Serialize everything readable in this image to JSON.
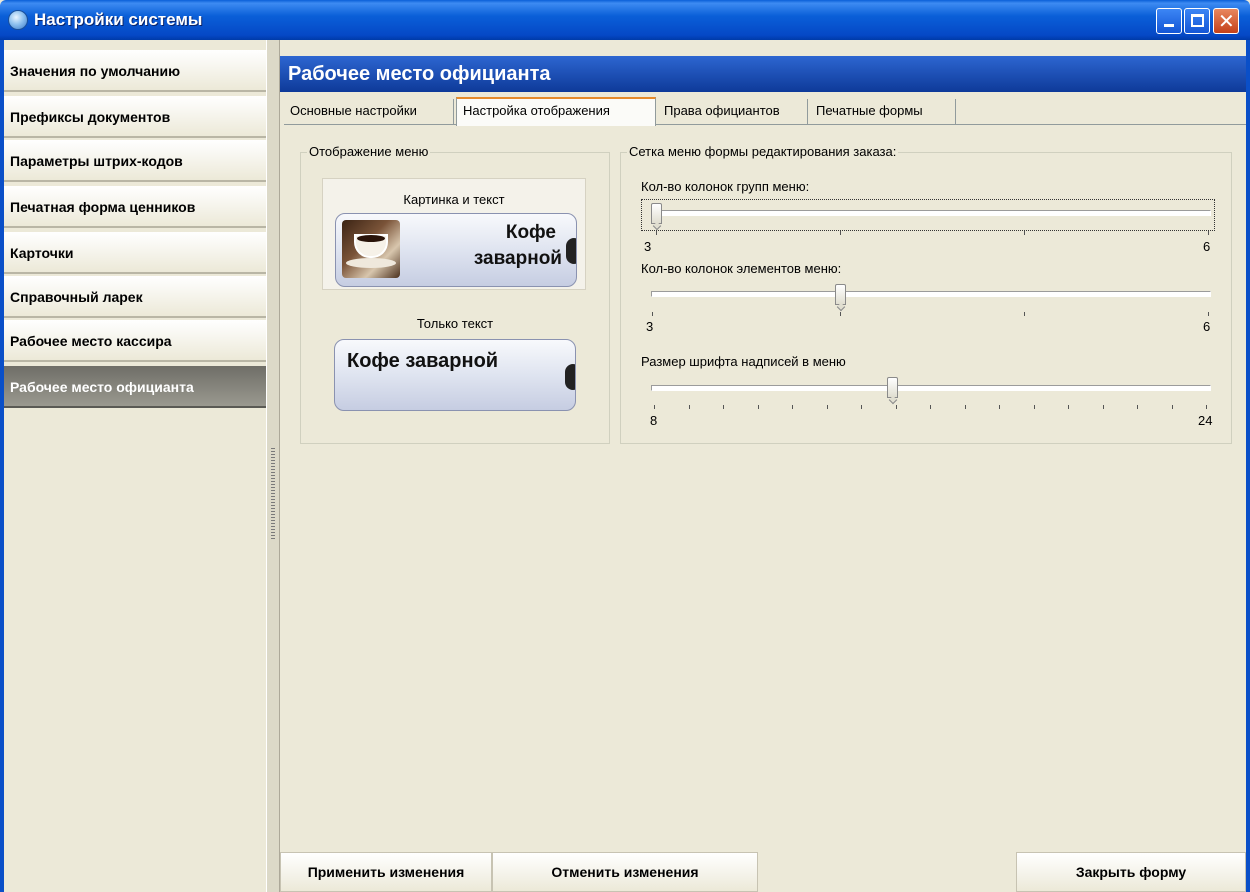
{
  "window": {
    "title": "Настройки системы",
    "icon": "app-globe-icon"
  },
  "sidebar": {
    "items": [
      {
        "label": "Значения по умолчанию"
      },
      {
        "label": "Префиксы документов"
      },
      {
        "label": "Параметры штрих-кодов"
      },
      {
        "label": "Печатная форма ценников"
      },
      {
        "label": "Карточки"
      },
      {
        "label": "Справочный ларек"
      },
      {
        "label": "Рабочее место кассира"
      },
      {
        "label": "Рабочее место официанта",
        "selected": true
      }
    ]
  },
  "main": {
    "header": "Рабочее место официанта",
    "tabs": [
      {
        "label": "Основные настройки"
      },
      {
        "label": "Настройка отображения",
        "selected": true
      },
      {
        "label": "Права официантов"
      },
      {
        "label": "Печатные формы"
      }
    ],
    "menu_display": {
      "title": "Отображение меню",
      "picture_and_text": {
        "caption": "Картинка и текст",
        "button_line1": "Кофе",
        "button_line2": "заварной",
        "selected": true
      },
      "text_only": {
        "caption": "Только текст",
        "button_text": "Кофе заварной"
      }
    },
    "grid": {
      "title": "Сетка меню формы редактирования заказа:",
      "sliders": [
        {
          "label": "Кол-во колонок групп меню:",
          "min": "3",
          "max": "6",
          "value": 3
        },
        {
          "label": "Кол-во колонок элементов меню:",
          "min": "3",
          "max": "6",
          "value": 4
        },
        {
          "label": "Размер шрифта надписей в меню",
          "min": "8",
          "max": "24",
          "value": 13
        }
      ]
    }
  },
  "footer": {
    "apply": "Применить изменения",
    "cancel": "Отменить изменения",
    "close": "Закрыть форму"
  },
  "colors": {
    "titlebar": "#0a5fd8",
    "header": "#1e4fb5",
    "active_tab_accent": "#e68b2c",
    "selected_sidebar": "#7a7970"
  }
}
